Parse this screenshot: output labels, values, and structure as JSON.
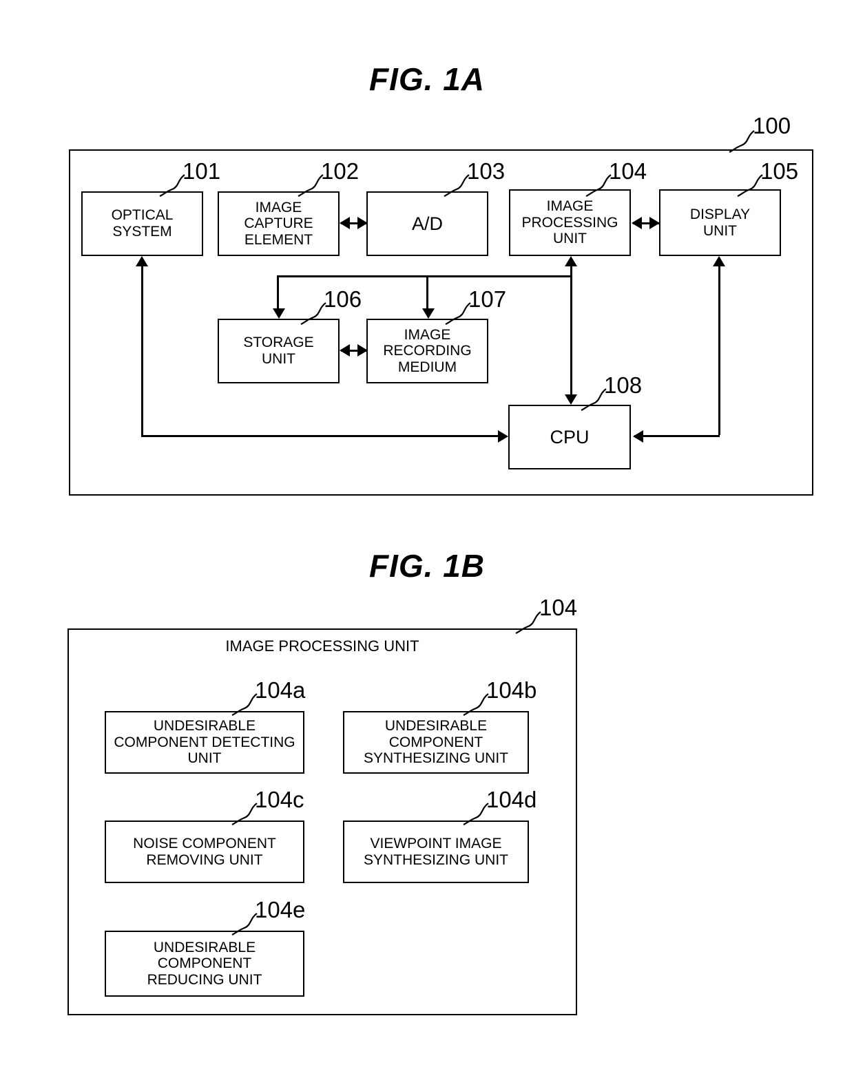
{
  "figures": {
    "fig_a": {
      "title": "FIG. 1A",
      "system_ref": "100",
      "blocks": [
        {
          "ref": "101",
          "label": "OPTICAL\nSYSTEM"
        },
        {
          "ref": "102",
          "label": "IMAGE\nCAPTURE\nELEMENT"
        },
        {
          "ref": "103",
          "label": "A/D"
        },
        {
          "ref": "104",
          "label": "IMAGE\nPROCESSING\nUNIT"
        },
        {
          "ref": "105",
          "label": "DISPLAY\nUNIT"
        },
        {
          "ref": "106",
          "label": "STORAGE\nUNIT"
        },
        {
          "ref": "107",
          "label": "IMAGE\nRECORDING\nMEDIUM"
        },
        {
          "ref": "108",
          "label": "CPU"
        }
      ]
    },
    "fig_b": {
      "title": "FIG. 1B",
      "unit_ref": "104",
      "heading": "IMAGE PROCESSING UNIT",
      "blocks": [
        {
          "ref": "104a",
          "label": "UNDESIRABLE\nCOMPONENT DETECTING\nUNIT"
        },
        {
          "ref": "104b",
          "label": "UNDESIRABLE\nCOMPONENT\nSYNTHESIZING UNIT"
        },
        {
          "ref": "104c",
          "label": "NOISE COMPONENT\nREMOVING UNIT"
        },
        {
          "ref": "104d",
          "label": "VIEWPOINT IMAGE\nSYNTHESIZING UNIT"
        },
        {
          "ref": "104e",
          "label": "UNDESIRABLE\nCOMPONENT\nREDUCING UNIT"
        }
      ]
    }
  },
  "colors": {
    "line": "#000000",
    "background": "#ffffff"
  }
}
